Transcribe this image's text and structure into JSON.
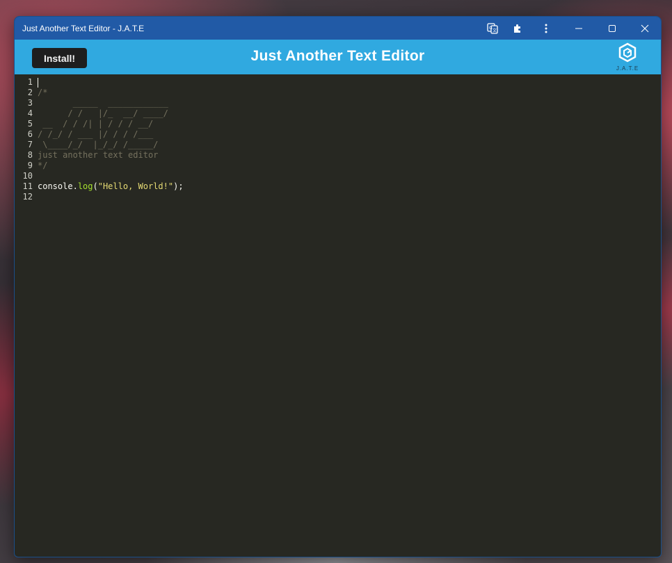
{
  "window": {
    "title": "Just Another Text Editor - J.A.T.E",
    "icons": [
      "translate-icon",
      "extensions-icon",
      "more-icon",
      "minimize-icon",
      "maximize-icon",
      "close-icon"
    ]
  },
  "header": {
    "install_label": "Install!",
    "title": "Just Another Text Editor",
    "logo_text": "J.A.T.E"
  },
  "editor": {
    "theme_colors": {
      "background": "#272822",
      "comment": "#75715e",
      "function": "#a6e22e",
      "string": "#e6db74",
      "text": "#f8f8f2"
    },
    "line_numbers": [
      "1",
      "2",
      "3",
      "4",
      "5",
      "6",
      "7",
      "8",
      "9",
      "10",
      "11",
      "12"
    ],
    "lines": {
      "l2": "/*",
      "l3": "       _____  ____________",
      "l4": "      / /   |/_  __/ ____/",
      "l5": " __  / / /| | / / / __/",
      "l6": "/ /_/ / ___ |/ / / /___",
      "l7": " \\____/_/  |_/_/ /_____/",
      "l8": "just another text editor",
      "l9": "*/",
      "l11_obj": "console",
      "l11_dot": ".",
      "l11_fn": "log",
      "l11_open": "(",
      "l11_str": "\"Hello, World!\"",
      "l11_close": ");"
    }
  }
}
